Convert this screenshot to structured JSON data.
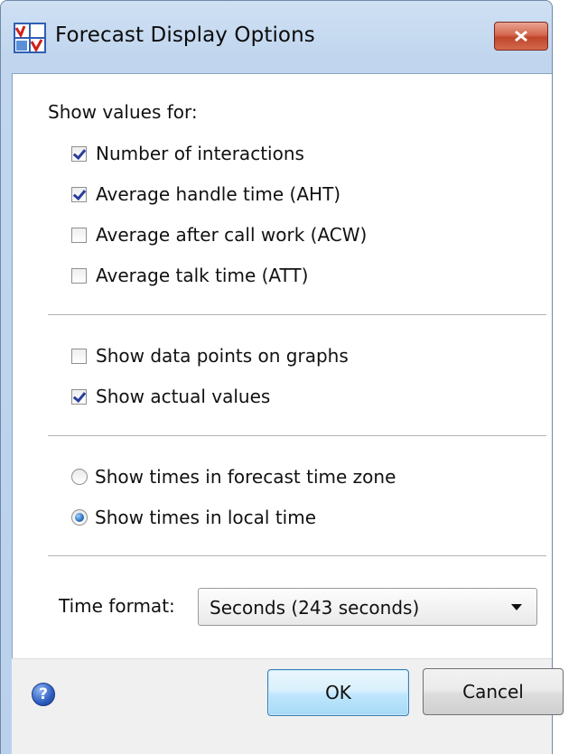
{
  "window": {
    "title": "Forecast Display Options",
    "close_symbol": "✕"
  },
  "show_values": {
    "label": "Show values for:",
    "items": [
      {
        "label": "Number of interactions",
        "checked": true
      },
      {
        "label": "Average handle time (AHT)",
        "checked": true
      },
      {
        "label": "Average after call work (ACW)",
        "checked": false
      },
      {
        "label": "Average talk time (ATT)",
        "checked": false
      }
    ]
  },
  "graph_options": {
    "items": [
      {
        "label": "Show data points on graphs",
        "checked": false
      },
      {
        "label": "Show actual values",
        "checked": true
      }
    ]
  },
  "time_zone": {
    "options": [
      {
        "label": "Show times in forecast time zone",
        "selected": false
      },
      {
        "label": "Show times in local time",
        "selected": true
      }
    ]
  },
  "time_format": {
    "label": "Time format:",
    "value": "Seconds (243 seconds)"
  },
  "footer": {
    "help_symbol": "?",
    "ok_label": "OK",
    "cancel_label": "Cancel"
  },
  "colors": {
    "title_bar": "#c1d6ee",
    "close_button": "#c0452b",
    "check_mark": "#2a3e9c",
    "radio_dot": "#2a6fbf",
    "ok_button": "#bee6fd"
  },
  "icons": {
    "app": "forecast-app-icon",
    "close": "close-icon",
    "help": "help-icon",
    "dropdown": "chevron-down-icon"
  }
}
